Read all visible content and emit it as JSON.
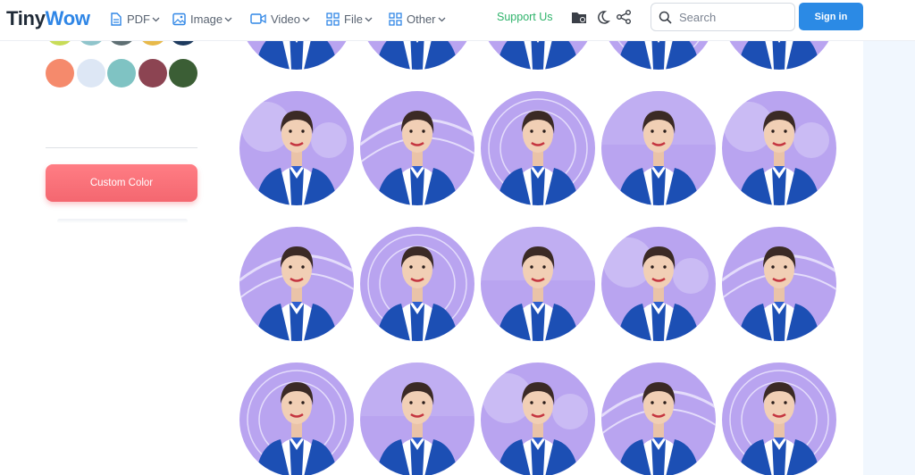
{
  "header": {
    "logo_part1": "Tiny",
    "logo_part2": "Wow",
    "nav": [
      {
        "label": "PDF",
        "icon": "document-icon"
      },
      {
        "label": "Image",
        "icon": "image-icon"
      },
      {
        "label": "Video",
        "icon": "video-icon"
      },
      {
        "label": "File",
        "icon": "grid-icon"
      },
      {
        "label": "Other",
        "icon": "grid-icon"
      }
    ],
    "support": "Support Us",
    "search_placeholder": "Search",
    "signin": "Sign in"
  },
  "sidebar": {
    "custom_color_label": "Custom Color",
    "swatch_colors_top": [
      "#c8dc58",
      "#8fc4cb",
      "#5e6f73",
      "#e7b94a",
      "#1d3a5e"
    ],
    "swatch_colors": [
      "#f58a6c",
      "#dde7f5",
      "#7fc3c3",
      "#8c4452",
      "#3b5e35"
    ]
  },
  "colors": {
    "accent": "#2b8ae5",
    "support": "#2fb36b",
    "custom_button": "#f46770",
    "avatar_bg": "#b9a4f0",
    "uniform": "#1c4fb4"
  },
  "gallery": {
    "row_count": 4,
    "col_count": 5,
    "item_name": "avatar-result"
  }
}
